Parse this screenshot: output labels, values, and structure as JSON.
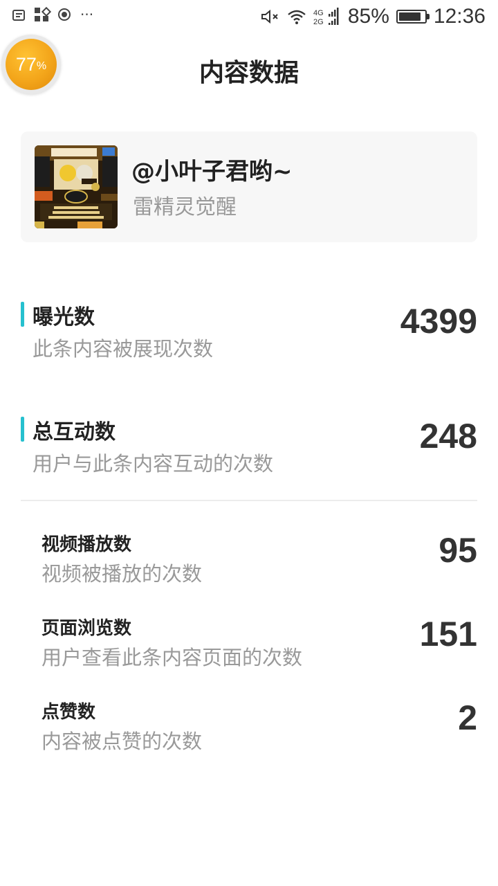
{
  "status_bar": {
    "battery_percent": "85%",
    "battery_level": 0.85,
    "time": "12:36",
    "network_top": "4G",
    "network_bottom": "2G",
    "left_icons": [
      "message-icon",
      "apps-icon",
      "record-icon",
      "more-icon"
    ],
    "right_icons": [
      "mute-icon",
      "wifi-icon",
      "signal-icon",
      "battery-icon"
    ]
  },
  "float_badge": {
    "value": "77",
    "unit": "%",
    "color": "#f3a51a"
  },
  "header": {
    "title": "内容数据"
  },
  "content_card": {
    "author": "@小叶子君哟~",
    "title": "雷精灵觉醒",
    "thumbnail_icon": "game-screenshot-thumbnail"
  },
  "primary_metrics": [
    {
      "label": "曝光数",
      "description": "此条内容被展现次数",
      "value": "4399"
    },
    {
      "label": "总互动数",
      "description": "用户与此条内容互动的次数",
      "value": "248"
    }
  ],
  "secondary_metrics": [
    {
      "label": "视频播放数",
      "description": "视频被播放的次数",
      "value": "95"
    },
    {
      "label": "页面浏览数",
      "description": "用户查看此条内容页面的次数",
      "value": "151"
    },
    {
      "label": "点赞数",
      "description": "内容被点赞的次数",
      "value": "2"
    }
  ],
  "colors": {
    "accent": "#26c0cf",
    "text_primary": "#222222",
    "text_secondary": "#999999",
    "card_background": "#f7f7f7"
  }
}
